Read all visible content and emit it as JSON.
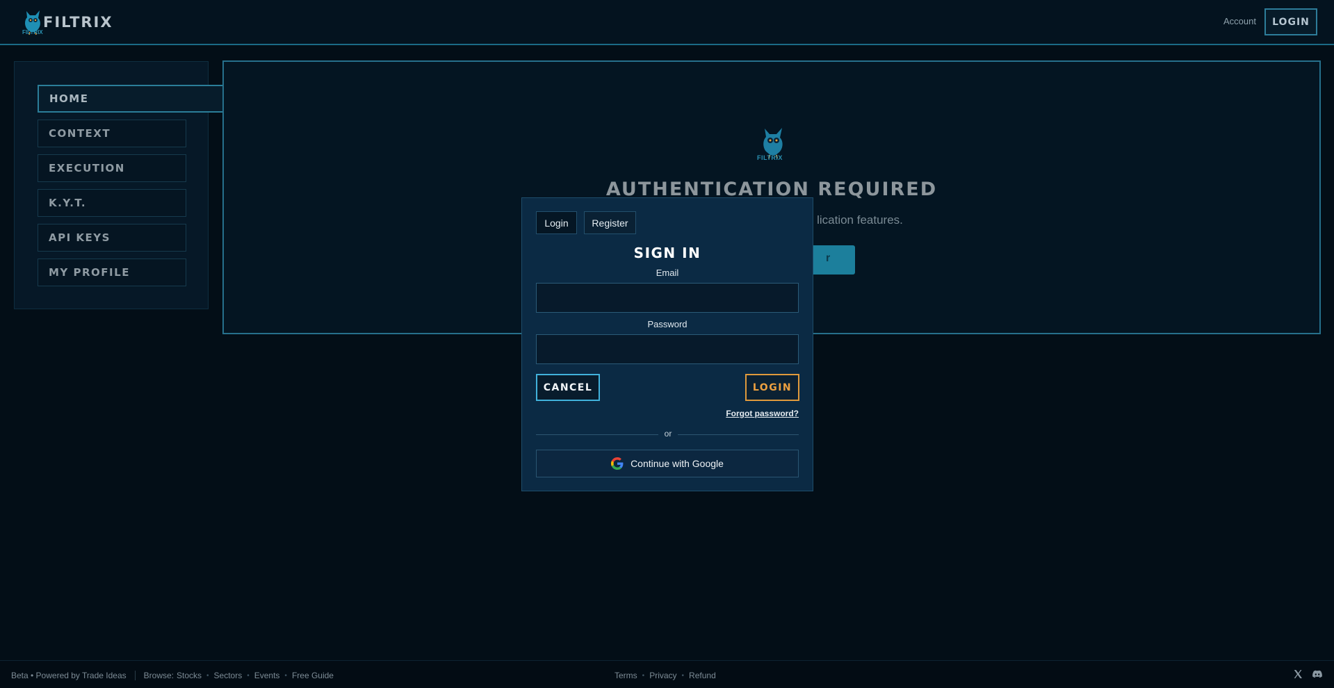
{
  "header": {
    "brand": "FILTRIX",
    "brand_sub": "FILTRIX",
    "account_link": "Account",
    "login_button": "LOGIN"
  },
  "sidebar": {
    "items": [
      {
        "label": "HOME",
        "active": true
      },
      {
        "label": "CONTEXT"
      },
      {
        "label": "EXECUTION"
      },
      {
        "label": "K.Y.T."
      },
      {
        "label": "API KEYS"
      },
      {
        "label": "MY PROFILE"
      }
    ]
  },
  "main": {
    "logo_label": "FILTRIX",
    "title": "AUTHENTICATION REQUIRED",
    "subtitle_visible": "lication features.",
    "button_visible": "r"
  },
  "modal": {
    "tabs": [
      {
        "label": "Login",
        "active": true
      },
      {
        "label": "Register"
      }
    ],
    "title": "SIGN IN",
    "email_label": "Email",
    "email_value": "",
    "password_label": "Password",
    "password_value": "",
    "cancel_button": "CANCEL",
    "login_button": "LOGIN",
    "forgot_link": "Forgot password?",
    "divider_text": "or",
    "google_button": "Continue with Google"
  },
  "footer": {
    "beta_text": "Beta • Powered by Trade Ideas",
    "browse_label": "Browse:",
    "browse_links": [
      "Stocks",
      "Sectors",
      "Events",
      "Free Guide"
    ],
    "legal_links": [
      "Terms",
      "Privacy",
      "Refund"
    ],
    "social_icons": [
      "x-icon",
      "discord-icon"
    ]
  },
  "colors": {
    "accent": "#26708c",
    "login_orange": "#e09a3c",
    "cancel_blue": "#41b2dc",
    "modal_bg": "#0b2a44"
  }
}
